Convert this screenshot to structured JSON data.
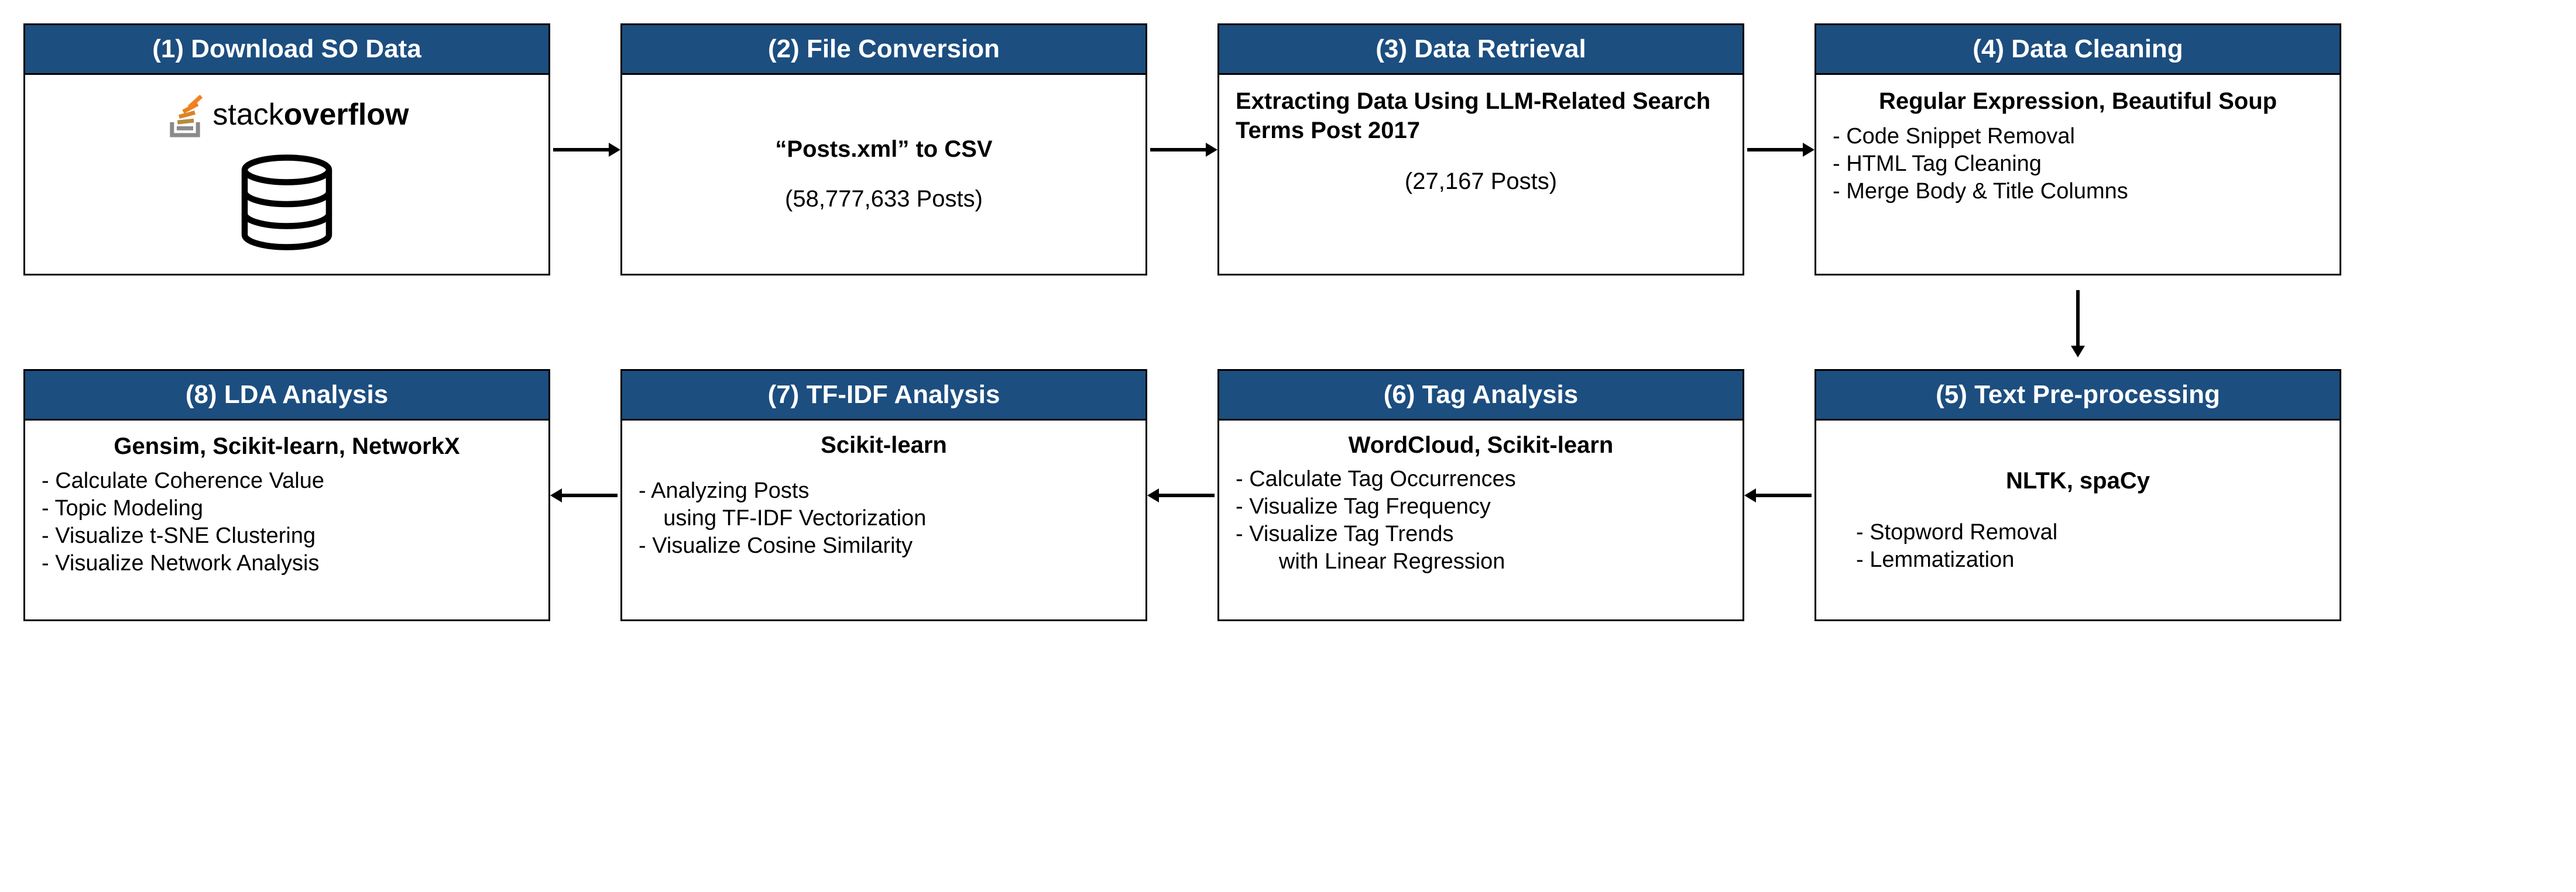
{
  "steps": {
    "s1": {
      "title": "(1) Download SO Data",
      "logo_stack": "stack",
      "logo_overflow": "overflow"
    },
    "s2": {
      "title": "(2) File Conversion",
      "heading": "“Posts.xml” to CSV",
      "subtext": "(58,777,633 Posts)"
    },
    "s3": {
      "title": "(3) Data Retrieval",
      "heading": "Extracting Data Using LLM-Related Search Terms Post 2017",
      "subtext": "(27,167 Posts)"
    },
    "s4": {
      "title": "(4) Data Cleaning",
      "heading": "Regular Expression, Beautiful Soup",
      "b1": "- Code Snippet Removal",
      "b2": "- HTML Tag Cleaning",
      "b3": "- Merge Body & Title Columns"
    },
    "s5": {
      "title": "(5) Text Pre-processing",
      "heading": "NLTK, spaCy",
      "b1": "- Stopword Removal",
      "b2": "- Lemmatization"
    },
    "s6": {
      "title": "(6) Tag Analysis",
      "heading": "WordCloud, Scikit-learn",
      "b1": "- Calculate Tag Occurrences",
      "b2": "- Visualize Tag Frequency",
      "b3": "- Visualize Tag Trends",
      "b4": "       with Linear Regression"
    },
    "s7": {
      "title": "(7) TF-IDF Analysis",
      "heading": "Scikit-learn",
      "b1": "- Analyzing Posts",
      "b2": "    using TF-IDF Vectorization",
      "b3": "- Visualize Cosine Similarity"
    },
    "s8": {
      "title": "(8) LDA Analysis",
      "heading": "Gensim, Scikit-learn, NetworkX",
      "b1": "- Calculate Coherence Value",
      "b2": "- Topic Modeling",
      "b3": "- Visualize t-SNE Clustering",
      "b4": "- Visualize Network Analysis"
    }
  }
}
